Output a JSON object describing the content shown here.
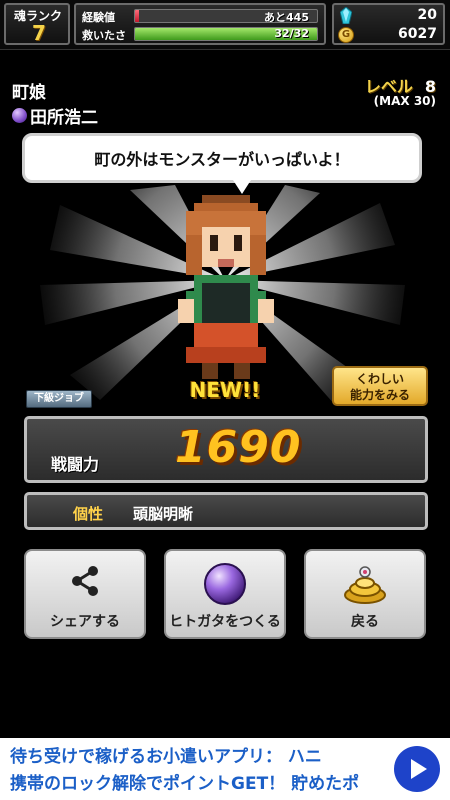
{
  "status": {
    "soul_rank_label": "魂ランク",
    "soul_rank_value": "7",
    "exp_label": "経験値",
    "exp_text": "あと445",
    "exp_fill": 0.02,
    "rescue_label": "救いたさ",
    "rescue_text": "32/32",
    "rescue_fill": 1.0,
    "gems": "20",
    "gold": "6027",
    "coin_glyph": "G",
    "exp_color": "#c2182c",
    "rescue_color": "#3f9a1c"
  },
  "character": {
    "job": "町娘",
    "owner": "田所浩二",
    "level_label": "レベル",
    "level": "8",
    "level_max": "(MAX 30)",
    "speech": "町の外はモンスターがいっぱいよ！",
    "new_badge": "NEW!!",
    "rank_tag": "下級ジョブ",
    "detail_button": [
      "くわしい",
      "能力をみる"
    ]
  },
  "stats": {
    "power_label": "戦闘力",
    "power_value": "1690",
    "trait_label": "個性",
    "trait_value": "頭脳明晰"
  },
  "actions": {
    "share": "シェアする",
    "make": "ヒトガタをつくる",
    "back": "戻る"
  },
  "ad": {
    "line1": "待ち受けで稼げるお小遣いアプリ： ハニ",
    "line2": "携帯のロック解除でポイントGET！ 貯めたポ"
  }
}
